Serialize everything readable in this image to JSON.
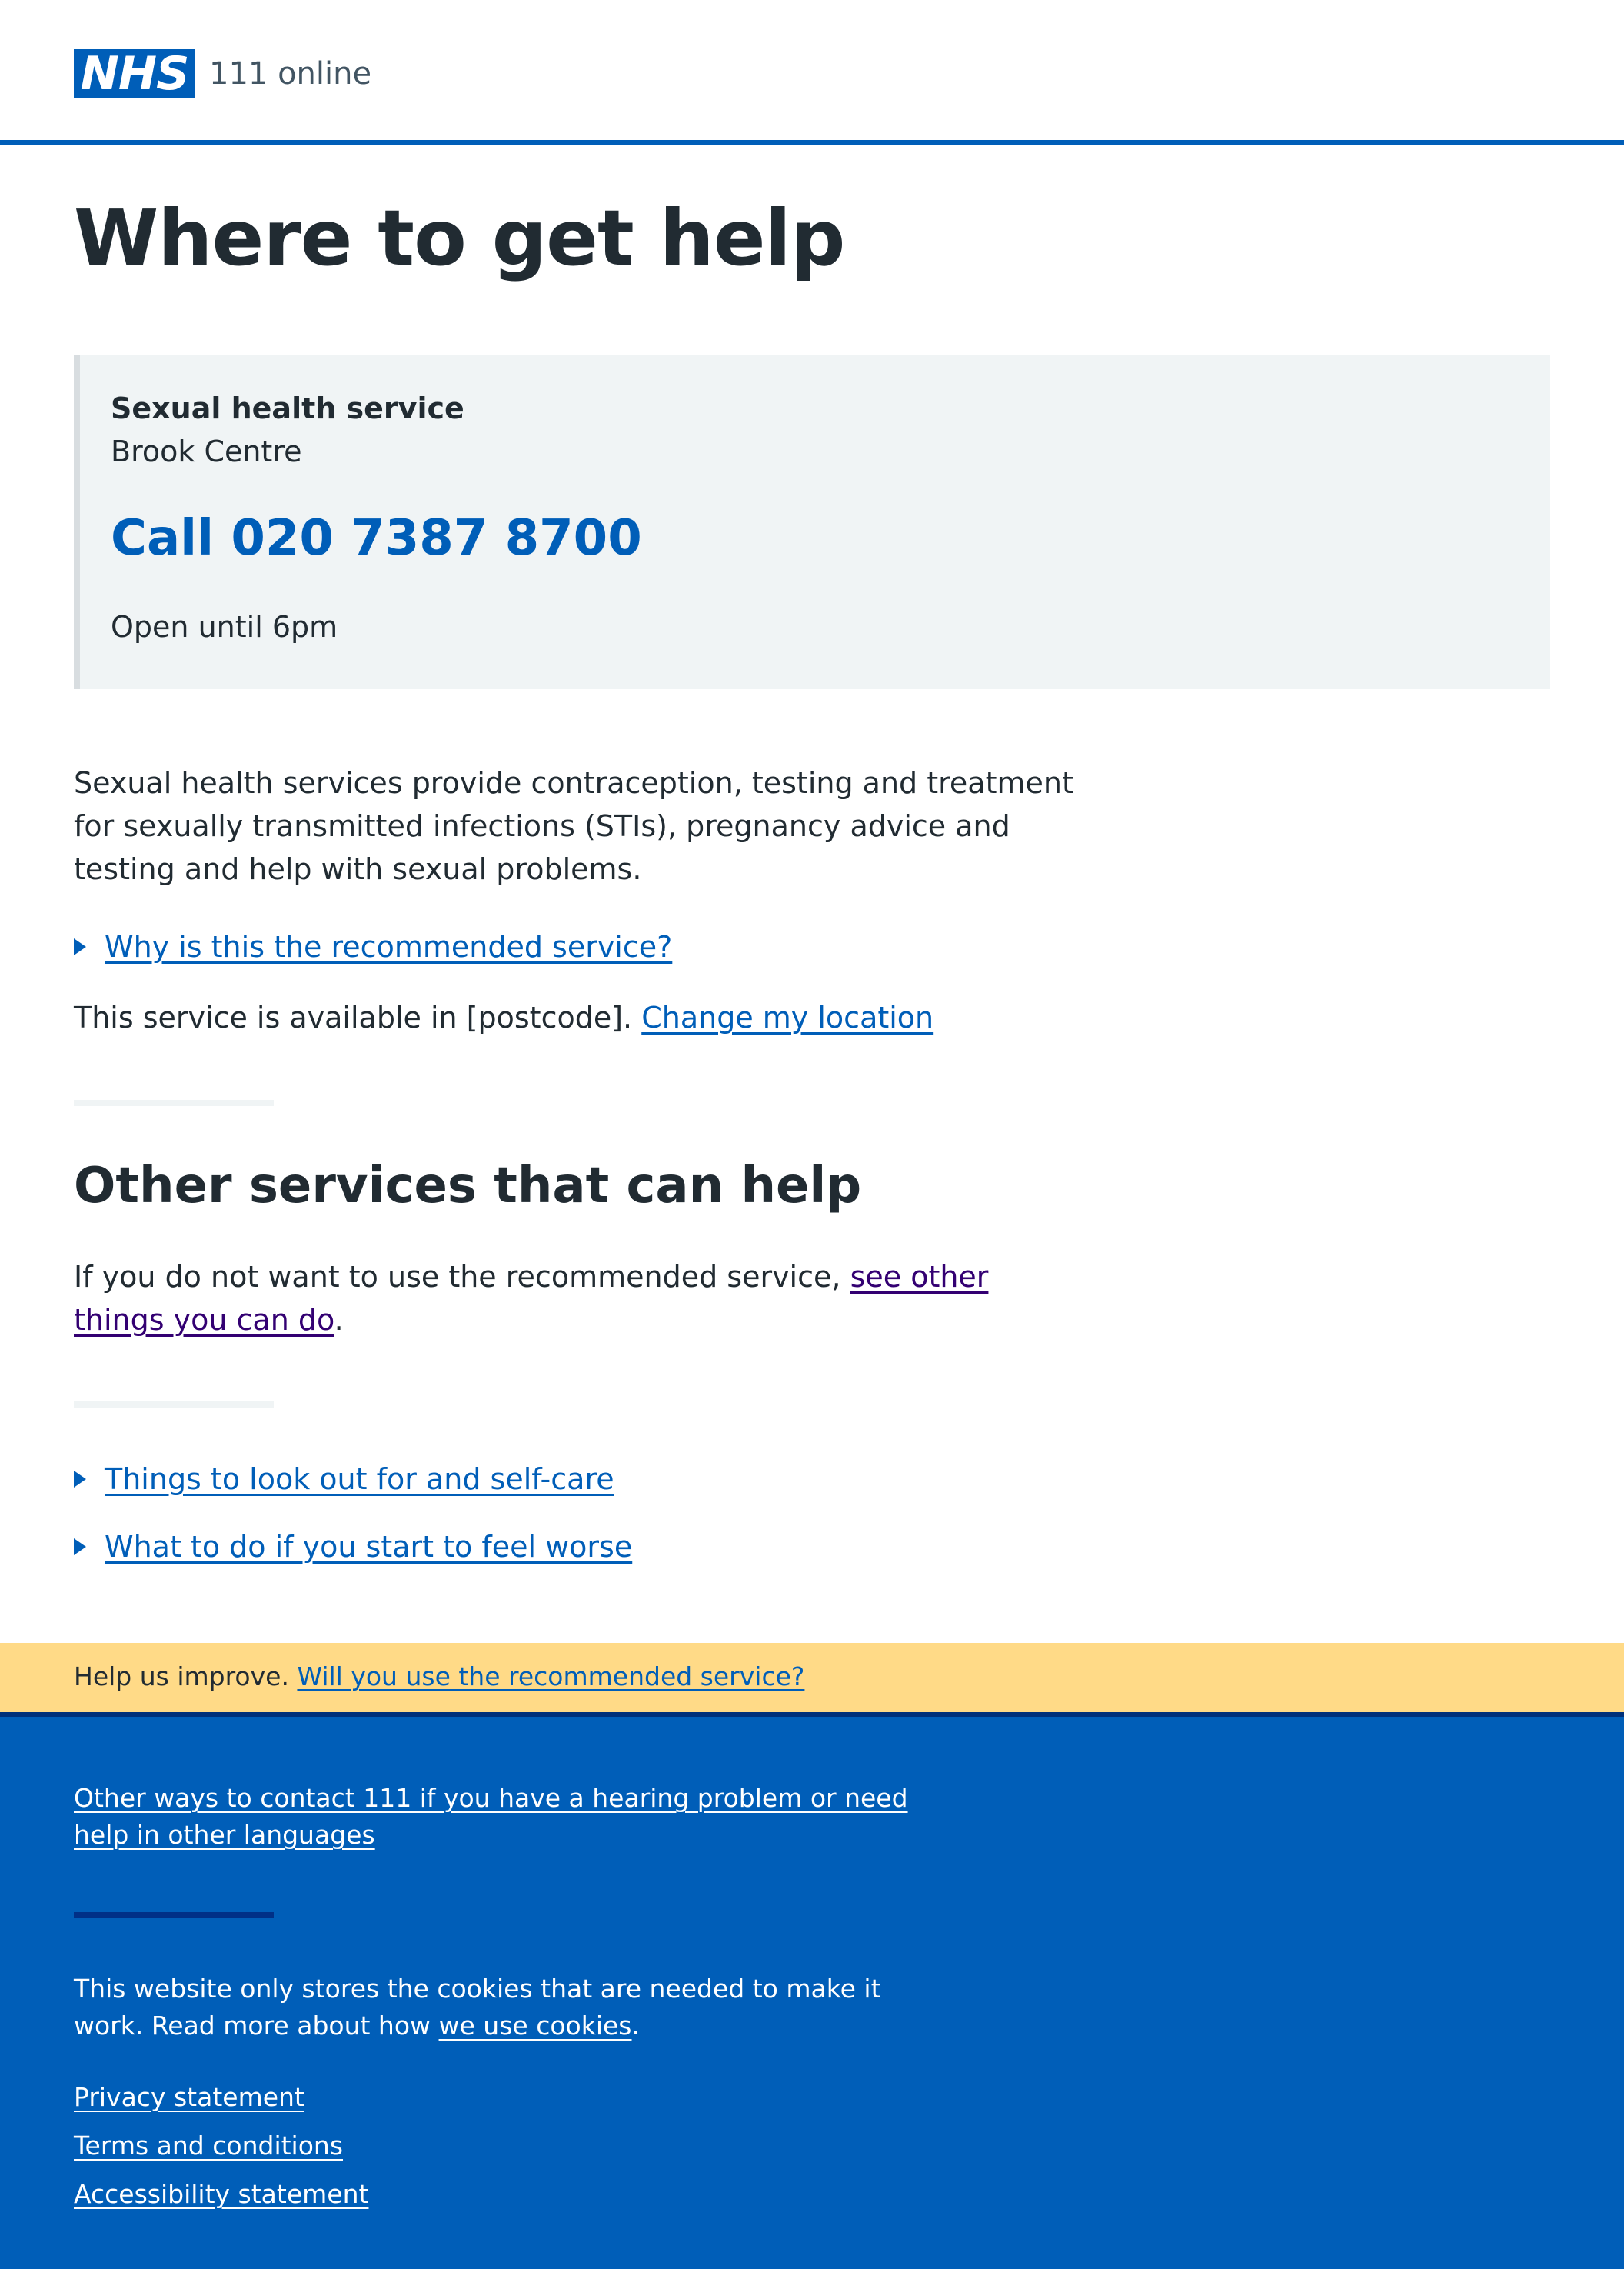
{
  "header": {
    "logo": "NHS",
    "service_name": "111 online"
  },
  "page_title": "Where to get help",
  "service_card": {
    "type": "Sexual health service",
    "name": "Brook Centre",
    "call": "Call 020 7387 8700",
    "hours": "Open until 6pm"
  },
  "description": "Sexual health services provide contraception, testing and treatment for sexually transmitted infections (STIs), pregnancy advice and testing and help with sexual problems.",
  "why_recommended": "Why is this the recommended service?",
  "location": {
    "text": "This service is available in [postcode].",
    "link": "Change my location"
  },
  "other_services": {
    "title": "Other services that can help",
    "text": "If you do not want to use the recommended service,",
    "link": "see other things you can do",
    "end": "."
  },
  "expanders": [
    "Things to look out for and self-care",
    "What to do if you start to feel worse"
  ],
  "feedback": {
    "text": "Help us improve.",
    "link": "Will you use the recommended service?"
  },
  "footer": {
    "contact_link": "Other ways to contact 111 if you have a hearing problem or need help in other languages",
    "cookie_text": "This website only stores the cookies that are needed to make it work. Read more about how",
    "cookie_link": "we use cookies",
    "cookie_end": ".",
    "links": [
      "Privacy statement",
      "Terms and conditions",
      "Accessibility statement"
    ]
  },
  "colors": {
    "nhs_blue": "#005eb8",
    "text": "#212b32",
    "card_bg": "#f0f4f5",
    "feedback_bg": "#ffda87",
    "visited_link": "#330072"
  }
}
